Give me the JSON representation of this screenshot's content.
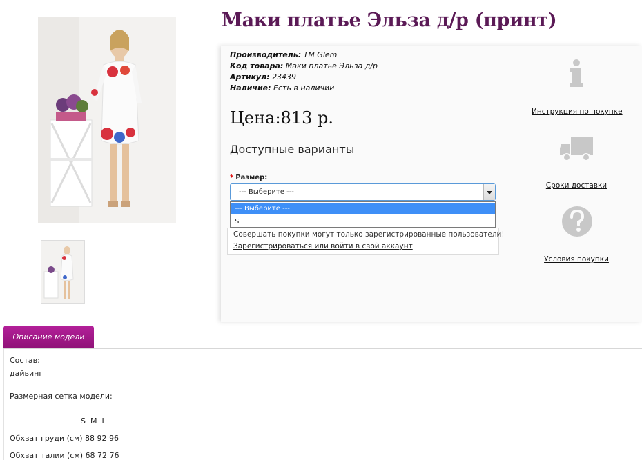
{
  "product": {
    "title": "Маки платье Эльза д/р (принт)",
    "manufacturer_label": "Производитель:",
    "manufacturer_value": "TM Glem",
    "code_label": "Код товара:",
    "code_value": "Маки платье Эльза д/р",
    "article_label": "Артикул:",
    "article_value": "23439",
    "availability_label": "Наличие:",
    "availability_value": "Есть в наличии",
    "price": "Цена:813 р."
  },
  "variants": {
    "heading": "Доступные варианты",
    "size_label": "Размер:",
    "required_mark": "*",
    "select_value": "--- Выберите ---",
    "options": [
      "--- Выберите ---",
      "S"
    ]
  },
  "notice": {
    "line1": "Совершать покупки могут только зарегистрированные пользователи!",
    "link": "Зарегистрироваться или войти в свой аккаунт"
  },
  "side": {
    "instruction_link": "Инструкция по покупке",
    "delivery_link": "Сроки доставки",
    "terms_link": "Условия покупки"
  },
  "description": {
    "tab_label": "Описание модели",
    "composition_label": "Состав:",
    "composition_value": "дайвинг",
    "size_chart_label": "Размерная сетка модели:",
    "sizes_header": "S  M  L",
    "row1": "Обхват груди (см) 88 92 96",
    "row2": "Обхват талии (см) 68 72 76"
  },
  "colors": {
    "title": "#5b1a56",
    "tab": "#a0188a",
    "select_highlight": "#3e8ff7",
    "icon_gray": "#c8c8c8"
  }
}
